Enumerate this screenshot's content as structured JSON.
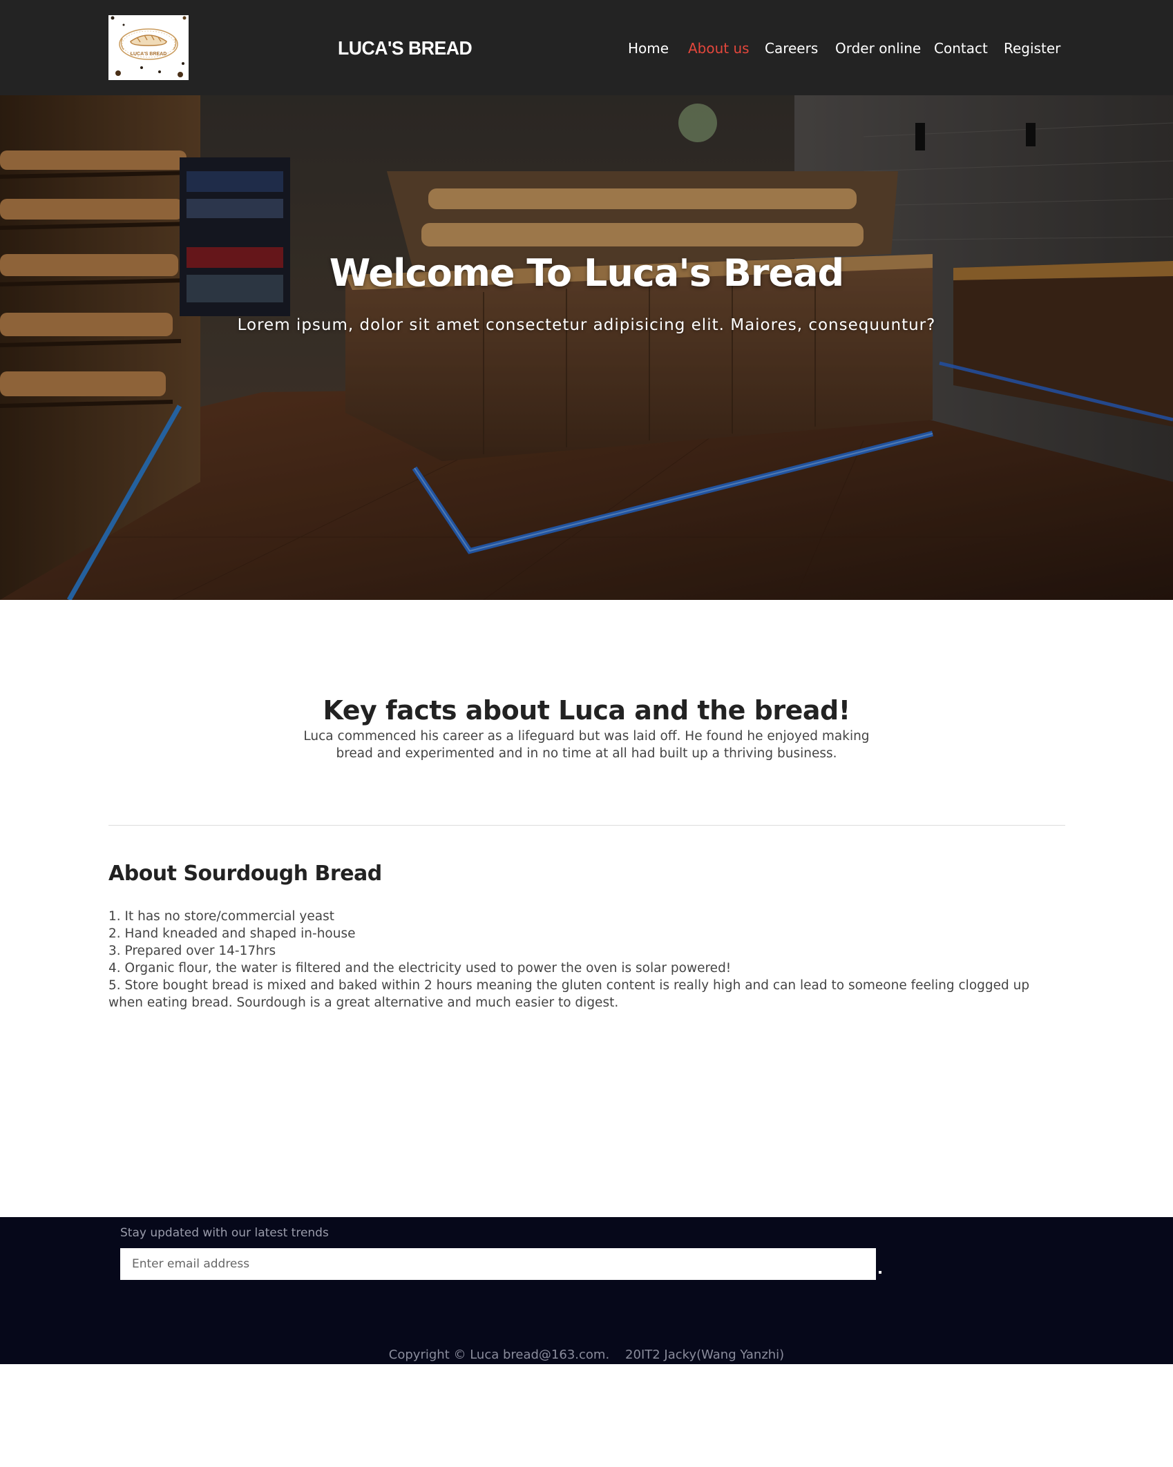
{
  "header": {
    "logo_text": "LUCA'S BREAD",
    "brand": "LUCA'S BREAD",
    "nav": [
      {
        "label": "Home",
        "active": false
      },
      {
        "label": "About us",
        "active": true
      },
      {
        "label": "Careers",
        "active": false
      },
      {
        "label": "Order online",
        "active": false
      },
      {
        "label": "Contact",
        "active": false
      },
      {
        "label": "Register",
        "active": false
      }
    ],
    "active_color": "#e4473c",
    "background": "#232323"
  },
  "hero": {
    "title": "Welcome To Luca's Bread",
    "subtitle": "Lorem ipsum, dolor sit amet consectetur adipisicing elit. Maiores, consequuntur?",
    "image": "bakery-interior"
  },
  "facts": {
    "title": "Key facts about Luca and the bread!",
    "body": "Luca commenced his career as a lifeguard but was laid off. He found he enjoyed making bread and experimented and in no time at all had built up a thriving business."
  },
  "about": {
    "title": "About Sourdough Bread",
    "items": [
      "1. It has no store/commercial yeast",
      "2. Hand kneaded and shaped in-house",
      "3. Prepared over 14-17hrs",
      "4. Organic flour, the water is filtered and the electricity used to power the oven is solar powered!",
      "5. Store bought bread is mixed and baked within 2 hours meaning the gluten content is really high and can lead to someone feeling clogged up when eating bread. Sourdough is a great alternative and much easier to digest."
    ]
  },
  "footer": {
    "note": "Stay updated with our latest trends",
    "email_placeholder": "Enter email address",
    "email_value": "",
    "copyright": "Copyright © Luca bread@163.com.    20IT2 Jacky(Wang Yanzhi)",
    "background": "#06081a"
  }
}
